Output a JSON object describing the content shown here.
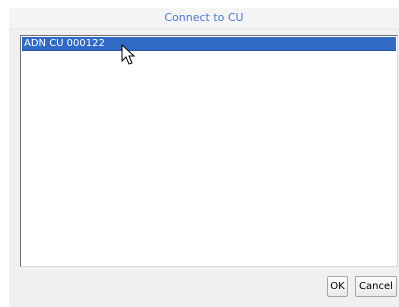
{
  "dialog": {
    "title": "Connect to CU"
  },
  "list": {
    "items": [
      {
        "label": "ADN CU 000122",
        "selected": true
      }
    ]
  },
  "buttons": {
    "ok_label": "OK",
    "cancel_label": "Cancel"
  },
  "colors": {
    "title_text": "#4b78c8",
    "selection": "#316ac5"
  },
  "icons": {
    "pointer": "mouse-pointer-icon"
  }
}
